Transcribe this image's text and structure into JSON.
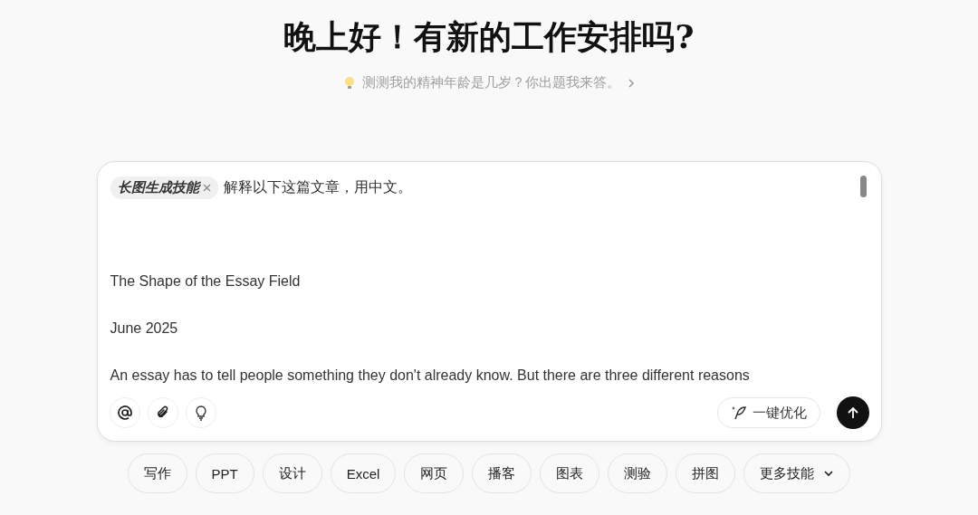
{
  "greeting": "晚上好！有新的工作安排吗?",
  "suggestion": {
    "text": "测测我的精神年龄是几岁？你出题我来答。"
  },
  "composer": {
    "skill_tag": "长图生成技能",
    "instruction": "解释以下这篇文章，用中文。",
    "body": [
      "The Shape of the Essay Field",
      "June 2025",
      "An essay has to tell people something they don't already know. But there are three different reasons"
    ],
    "optimize_label": "一键优化"
  },
  "skills": [
    {
      "label": "写作",
      "kind": "skill"
    },
    {
      "label": "PPT",
      "kind": "skill"
    },
    {
      "label": "设计",
      "kind": "skill"
    },
    {
      "label": "Excel",
      "kind": "skill"
    },
    {
      "label": "网页",
      "kind": "skill"
    },
    {
      "label": "播客",
      "kind": "skill"
    },
    {
      "label": "图表",
      "kind": "skill"
    },
    {
      "label": "测验",
      "kind": "skill"
    },
    {
      "label": "拼图",
      "kind": "skill"
    },
    {
      "label": "更多技能",
      "kind": "menu"
    }
  ]
}
